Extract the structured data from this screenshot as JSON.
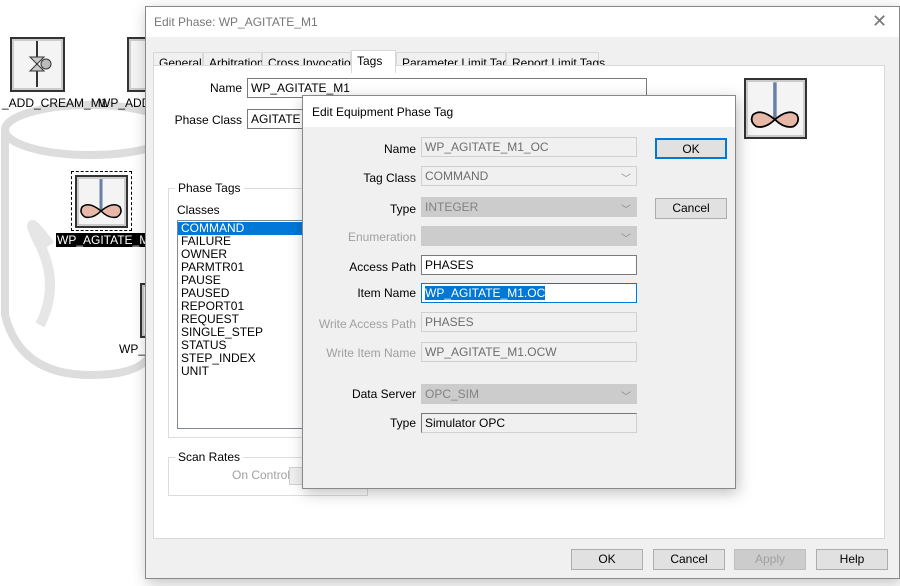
{
  "canvas": {
    "labels": [
      "_ADD_CREAM_M1",
      "WP_ADD",
      "WP_AGITATE_M1",
      "WP_"
    ]
  },
  "phase_dialog": {
    "title": "Edit Phase:  WP_AGITATE_M1",
    "close_icon": "close-icon",
    "tabs": [
      "General",
      "Arbitration",
      "Cross Invocation",
      "Tags",
      "Parameter Limit Tags",
      "Report Limit Tags"
    ],
    "selected_tab": "Tags",
    "name_label": "Name",
    "name_value": "WP_AGITATE_M1",
    "phase_class_label": "Phase Class",
    "phase_class_value": "AGITATE",
    "phase_tags_label": "Phase Tags",
    "classes_label": "Classes",
    "classes": [
      "COMMAND",
      "FAILURE",
      "OWNER",
      "PARMTR01",
      "PAUSE",
      "PAUSED",
      "REPORT01",
      "REQUEST",
      "SINGLE_STEP",
      "STATUS",
      "STEP_INDEX",
      "UNIT"
    ],
    "selected_class": "COMMAND",
    "scan_rates_label": "Scan Rates",
    "on_control_label": "On Control",
    "buttons": {
      "ok": "OK",
      "cancel": "Cancel",
      "apply": "Apply",
      "help": "Help"
    }
  },
  "tag_dialog": {
    "title": "Edit Equipment Phase Tag",
    "fields": {
      "name": {
        "label": "Name",
        "value": "WP_AGITATE_M1_OC"
      },
      "tag_class": {
        "label": "Tag Class",
        "value": "COMMAND"
      },
      "type": {
        "label": "Type",
        "value": "INTEGER"
      },
      "enumeration": {
        "label": "Enumeration",
        "value": ""
      },
      "access_path": {
        "label": "Access Path",
        "value": "PHASES"
      },
      "item_name": {
        "label": "Item Name",
        "value": "WP_AGITATE_M1.OC"
      },
      "write_access_path": {
        "label": "Write Access Path",
        "value": "PHASES"
      },
      "write_item_name": {
        "label": "Write Item Name",
        "value": "WP_AGITATE_M1.OCW"
      },
      "data_server": {
        "label": "Data Server",
        "value": "OPC_SIM"
      },
      "server_type": {
        "label": "Type",
        "value": "Simulator OPC"
      }
    },
    "buttons": {
      "ok": "OK",
      "cancel": "Cancel"
    }
  },
  "colors": {
    "accent": "#0078d7",
    "dialog_bg": "#f0f0f0"
  }
}
